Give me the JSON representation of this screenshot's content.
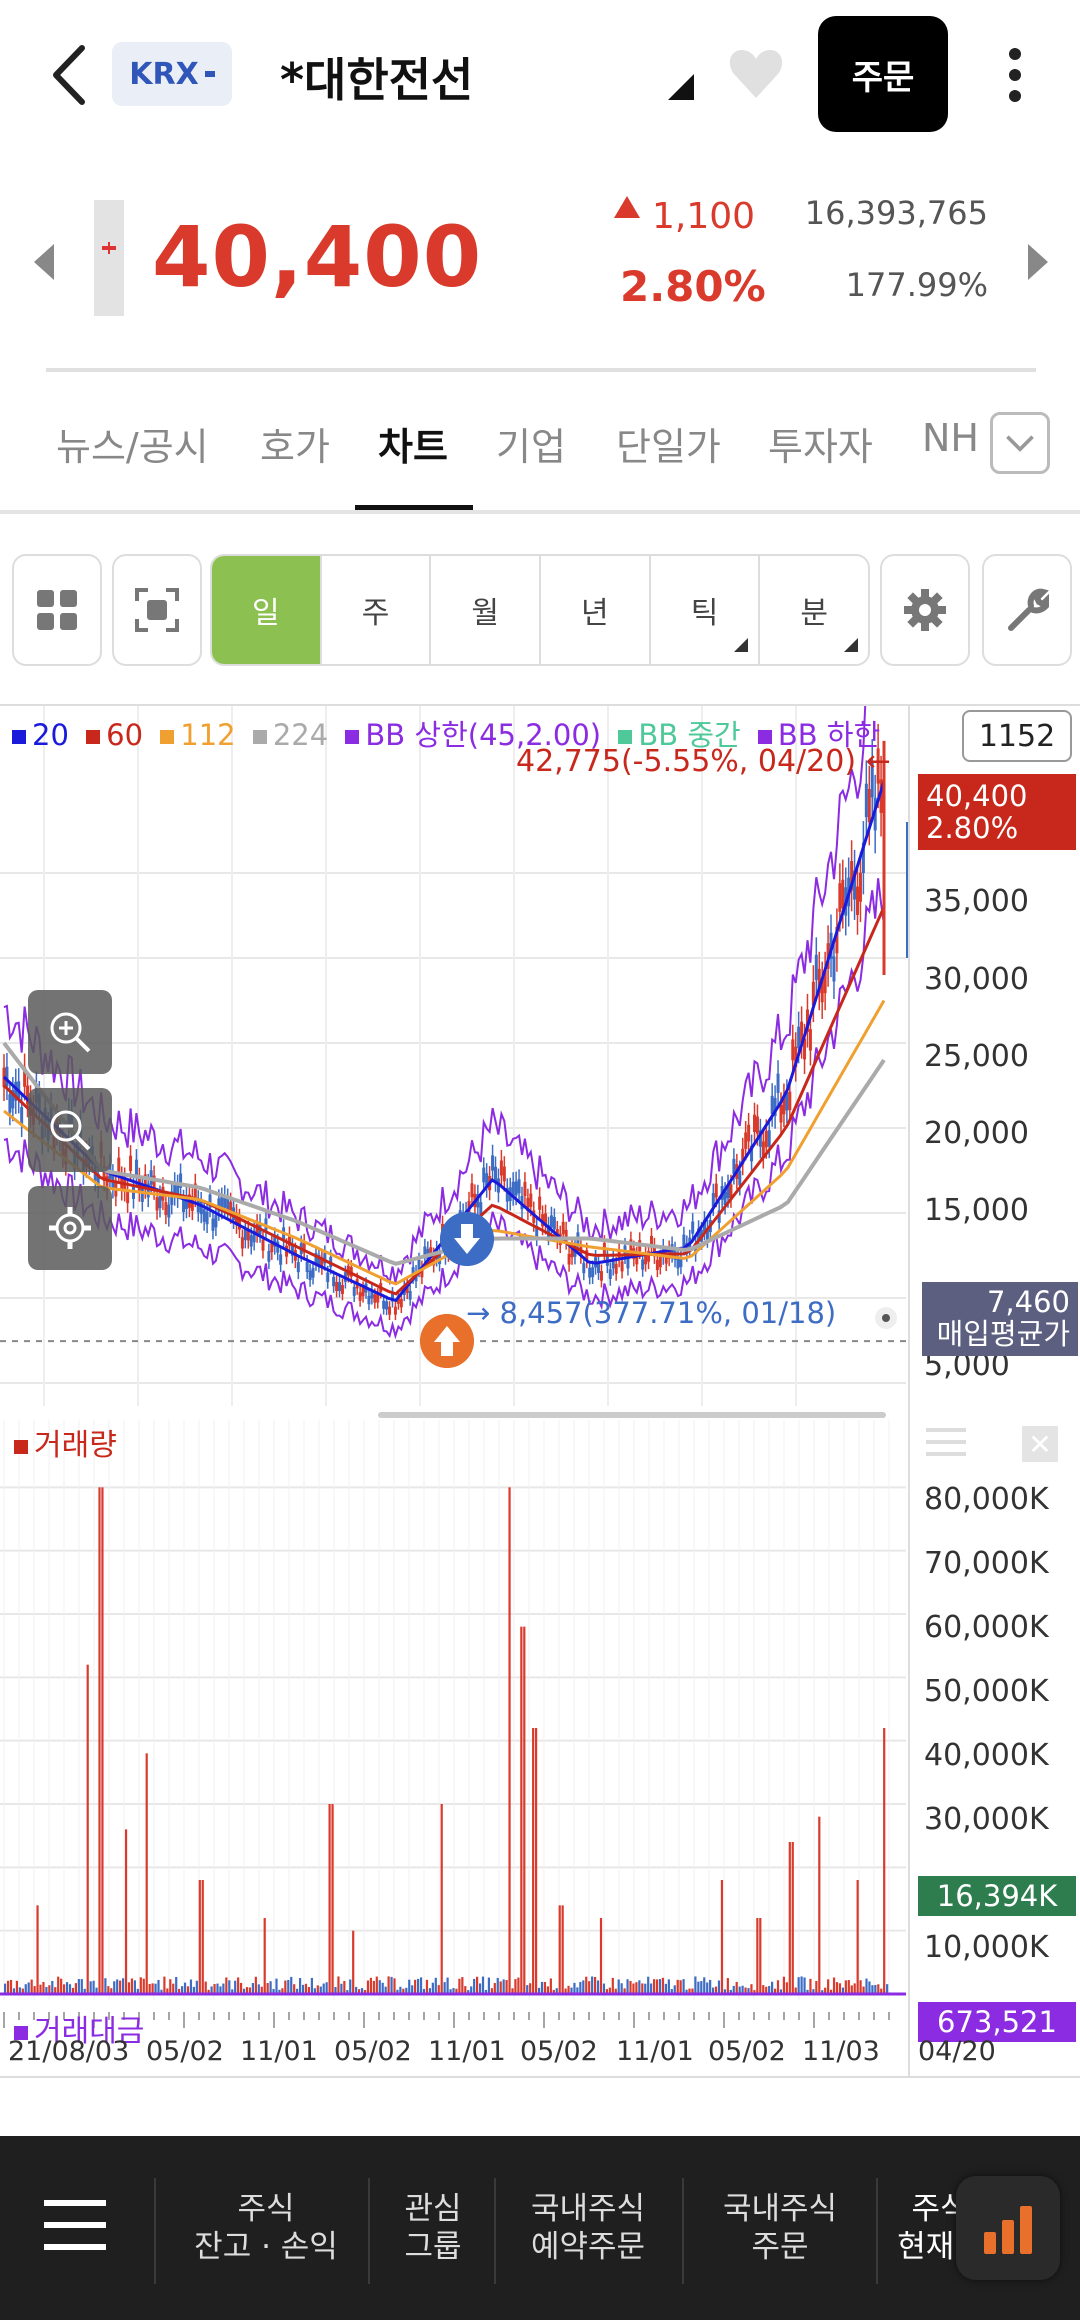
{
  "header": {
    "exchange_badge": "KRX",
    "stock_name": "*대한전선",
    "order_button": "주문"
  },
  "quote": {
    "price": "40,400",
    "change": "1,100",
    "change_pct": "2.80%",
    "volume": "16,393,765",
    "volume_ratio": "177.99%"
  },
  "tabs": [
    {
      "label": "뉴스/공시",
      "active": false
    },
    {
      "label": "호가",
      "active": false
    },
    {
      "label": "차트",
      "active": true
    },
    {
      "label": "기업",
      "active": false
    },
    {
      "label": "단일가",
      "active": false
    },
    {
      "label": "투자자",
      "active": false
    },
    {
      "label": "NH",
      "active": false
    }
  ],
  "periods": [
    {
      "label": "일",
      "active": true
    },
    {
      "label": "주",
      "active": false
    },
    {
      "label": "월",
      "active": false
    },
    {
      "label": "년",
      "active": false
    },
    {
      "label": "틱",
      "active": false
    },
    {
      "label": "분",
      "active": false
    }
  ],
  "legend": {
    "ma20": "20",
    "ma60": "60",
    "ma112": "112",
    "ma224": "224",
    "bb_upper": "BB 상한(45,2.00)",
    "bb_mid": "BB 중간",
    "bb_lower": "BB 하한"
  },
  "colors": {
    "ma20": "#1a1adb",
    "ma60": "#c8281c",
    "ma112": "#f0a030",
    "ma224": "#aaaaaa",
    "bb_upper": "#8b2be2",
    "bb_mid": "#4fc99a",
    "bb_lower": "#8b2be2",
    "up": "#d93a2b",
    "down": "#3d6cc4",
    "accent_green": "#8cc152"
  },
  "chart": {
    "candle_count": "1152",
    "high_note": "42,775(-5.55%, 04/20)",
    "low_note": "8,457(377.71%, 01/18)",
    "price_tag_line1": "40,400",
    "price_tag_line2": "2.80%",
    "avg_price_value": "7,460",
    "avg_price_label": "매입평균가",
    "volume_title": "거래량",
    "volume_tag": "16,394K",
    "amount_title": "거래대금",
    "amount_tag": "673,521"
  },
  "chart_data": [
    {
      "type": "line",
      "title": "",
      "x": [
        "21/08/03",
        "05/02",
        "11/01",
        "05/02",
        "11/01",
        "05/02",
        "11/01",
        "05/02",
        "11/03",
        "04/20"
      ],
      "series": [
        {
          "name": "20",
          "values": [
            23000,
            17500,
            15500,
            12500,
            9800,
            17000,
            12000,
            13000,
            22000,
            40400
          ]
        },
        {
          "name": "60",
          "values": [
            22500,
            17000,
            15800,
            13000,
            10200,
            15500,
            12500,
            12600,
            20000,
            33000
          ]
        },
        {
          "name": "112",
          "values": [
            21000,
            16500,
            15800,
            13500,
            10800,
            14000,
            13000,
            12300,
            17500,
            27500
          ]
        },
        {
          "name": "224",
          "values": [
            25000,
            17500,
            16500,
            14500,
            12000,
            13500,
            13500,
            12800,
            15500,
            24000
          ]
        }
      ],
      "y_ticks": [
        "35,000",
        "30,000",
        "25,000",
        "20,000",
        "15,000",
        "5,000"
      ],
      "ylim": [
        4000,
        44000
      ],
      "grid": true,
      "legend_position": "top-left"
    },
    {
      "type": "bar",
      "title": "거래량",
      "y_ticks": [
        "80,000K",
        "70,000K",
        "60,000K",
        "50,000K",
        "40,000K",
        "30,000K",
        "10,000K"
      ],
      "ylim": [
        0,
        90000
      ],
      "x_ticks": [
        "21/08/03",
        "05/02",
        "11/01",
        "05/02",
        "11/01",
        "05/02",
        "11/01",
        "05/02",
        "11/03",
        "04/20"
      ]
    }
  ],
  "bottom_nav": [
    {
      "label": "주식\n잔고 · 손익"
    },
    {
      "label": "관심\n그룹"
    },
    {
      "label": "국내주식\n예약주문"
    },
    {
      "label": "국내주식\n주문"
    },
    {
      "label": "주식\n현재가"
    }
  ]
}
